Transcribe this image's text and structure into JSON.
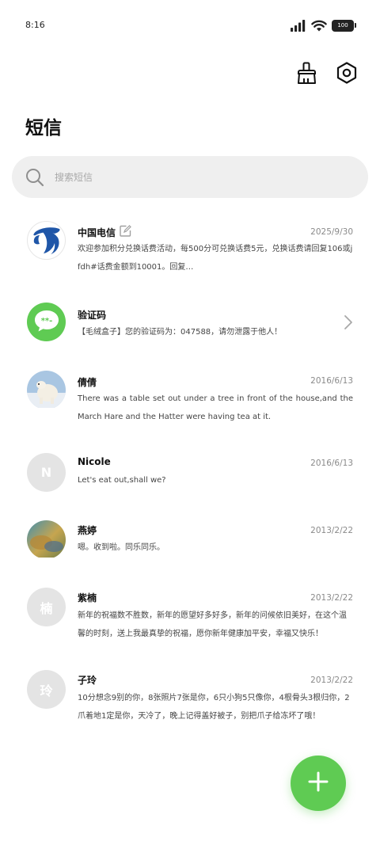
{
  "status_bar": {
    "time": "8:16",
    "battery": "100"
  },
  "page": {
    "title": "短信"
  },
  "search": {
    "placeholder": "搜索短信"
  },
  "colors": {
    "accent": "#5fcb53",
    "avatar_gray": "#e4e4e4",
    "telecom_blue": "#1f56a8"
  },
  "icons": {
    "toolbar": [
      "broom-icon",
      "settings-hexagon-icon"
    ],
    "fab": "plus-icon"
  },
  "conversations": [
    {
      "name": "中国电信",
      "date": "2025/9/30",
      "preview": "欢迎参加积分兑换话费活动，每500分可兑换话费5元，兑换话费请回复106或jfdh#话费金额到10001。回复…",
      "avatar": "china-telecom-logo"
    },
    {
      "name": "验证码",
      "date": "",
      "preview": "【毛绒盒子】您的验证码为：047588，请勿泄露于他人！",
      "avatar": "verification-code-icon",
      "avatar_text": "**-"
    },
    {
      "name": "倩倩",
      "date": "2016/6/13",
      "preview": "There was a table set out under a tree in front of the house,and the March Hare and the Hatter were having tea at it.",
      "avatar": "polar-bear-photo"
    },
    {
      "name": "Nicole",
      "date": "2016/6/13",
      "preview": "Let's eat out,shall we?",
      "avatar_letter": "N"
    },
    {
      "name": "燕婷",
      "date": "2013/2/22",
      "preview": "嗯。收到啦。同乐同乐。",
      "avatar": "landscape-photo"
    },
    {
      "name": "紫楠",
      "date": "2013/2/22",
      "preview": "新年的祝福数不胜数，新年的愿望好多好多，新年的问候依旧美好，在这个温馨的时刻，送上我最真挚的祝福，愿你新年健康加平安，幸福又快乐！",
      "avatar_letter": "楠"
    },
    {
      "name": "子玲",
      "date": "2013/2/22",
      "preview": "10分想念9别的你，8张照片7张是你，6只小狗5只像你，4根骨头3根归你，2爪着地1定是你，天冷了，晚上记得盖好被子，别把爪子给冻坏了哦！",
      "avatar_letter": "玲"
    }
  ]
}
